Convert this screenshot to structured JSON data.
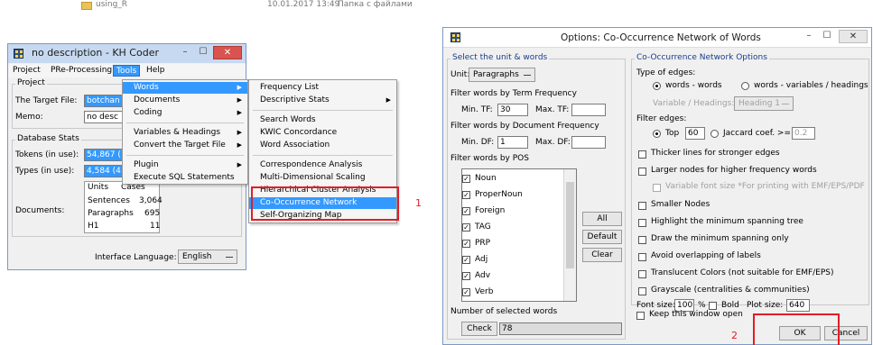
{
  "explorer": {
    "folder_name": "using_R",
    "date": "10.01.2017 13:49",
    "type": "Папка с файлами"
  },
  "kh_window": {
    "title": "no description - KH Coder",
    "controls": {
      "minimize": "–",
      "maximize": "☐",
      "close": "✕"
    },
    "menubar": [
      "Project",
      "PRe-Processing",
      "Tools",
      "Help"
    ],
    "project_label": "Project",
    "target_file_label": "The Target File:",
    "target_file_value": "botchan",
    "memo_label": "Memo:",
    "memo_value": "no desc",
    "db_stats_label": "Database Stats",
    "tokens_label": "Tokens (in use):",
    "tokens_value": "54,867 (",
    "types_label": "Types (in use):",
    "types_value": "4,584 (4",
    "documents_label": "Documents:",
    "table_header": [
      "Units",
      "Cases"
    ],
    "table_rows": [
      {
        "unit": "Sentences",
        "cases": "3,064"
      },
      {
        "unit": "Paragraphs",
        "cases": "695"
      },
      {
        "unit": "H1",
        "cases": "11"
      }
    ],
    "interface_language_label": "Interface Language:",
    "interface_language_value": "English"
  },
  "tools_menu": {
    "items": [
      "Words",
      "Documents",
      "Coding",
      "Variables & Headings",
      "Convert the Target File",
      "Plugin",
      "Execute SQL Statements"
    ]
  },
  "words_submenu": {
    "items": [
      "Frequency List",
      "Descriptive Stats",
      "Search Words",
      "KWIC Concordance",
      "Word Association",
      "Correspondence Analysis",
      "Multi-Dimensional Scaling",
      "Hierarchical Cluster Analysis",
      "Co-Occurrence Network",
      "Self-Organizing Map"
    ]
  },
  "annotations": {
    "step1": "1",
    "step2": "2"
  },
  "options_window": {
    "title": "Options: Co-Occurrence Network of Words",
    "controls": {
      "minimize": "–",
      "maximize": "☐",
      "close": "✕"
    },
    "left_group_title": "Select the unit & words",
    "unit_label": "Unit:",
    "unit_value": "Paragraphs",
    "tf_section": "Filter words by Term Frequency",
    "min_tf_label": "Min. TF:",
    "min_tf_value": "30",
    "max_tf_label": "Max. TF:",
    "max_tf_value": "",
    "df_section": "Filter words by Document Frequency",
    "min_df_label": "Min. DF:",
    "min_df_value": "1",
    "max_df_label": "Max. DF:",
    "max_df_value": "",
    "pos_section": "Filter words by POS",
    "pos_items": [
      "Noun",
      "ProperNoun",
      "Foreign",
      "TAG",
      "PRP",
      "Adj",
      "Adv",
      "Verb"
    ],
    "btn_all": "All",
    "btn_default": "Default",
    "btn_clear": "Clear",
    "selected_count_label": "Number of selected words",
    "check_button": "Check",
    "check_value": "78",
    "right_group_title": "Co-Occurrence Network Options",
    "edges_type_label": "Type of edges:",
    "edges_type_opt1": "words - words",
    "edges_type_opt2": "words - variables / headings",
    "var_headings_label": "Variable / Headings:",
    "var_headings_value": "Heading 1",
    "filter_edges_label": "Filter edges:",
    "top_label": "Top",
    "top_value": "60",
    "jaccard_label": "Jaccard coef. >=",
    "jaccard_value": "0.2",
    "opt_thicker": "Thicker lines for stronger edges",
    "opt_larger": "Larger nodes for higher frequency words",
    "opt_variable_font": "Variable font size *For printing with EMF/EPS/PDF",
    "opt_smaller": "Smaller Nodes",
    "opt_highlight": "Highlight the minimum spanning tree",
    "opt_draw_only": "Draw the minimum spanning only",
    "opt_avoid": "Avoid overlapping of labels",
    "opt_translucent": "Translucent Colors (not suitable for EMF/EPS)",
    "opt_grayscale": "Grayscale (centralities & communities)",
    "font_size_label": "Font size:",
    "font_size_value": "100",
    "font_size_unit": "%",
    "bold_label": "Bold",
    "plot_size_label": "Plot size:",
    "plot_size_value": "640",
    "keep_open_label": "Keep this window open",
    "ok_button": "OK",
    "cancel_button": "Cancel"
  }
}
